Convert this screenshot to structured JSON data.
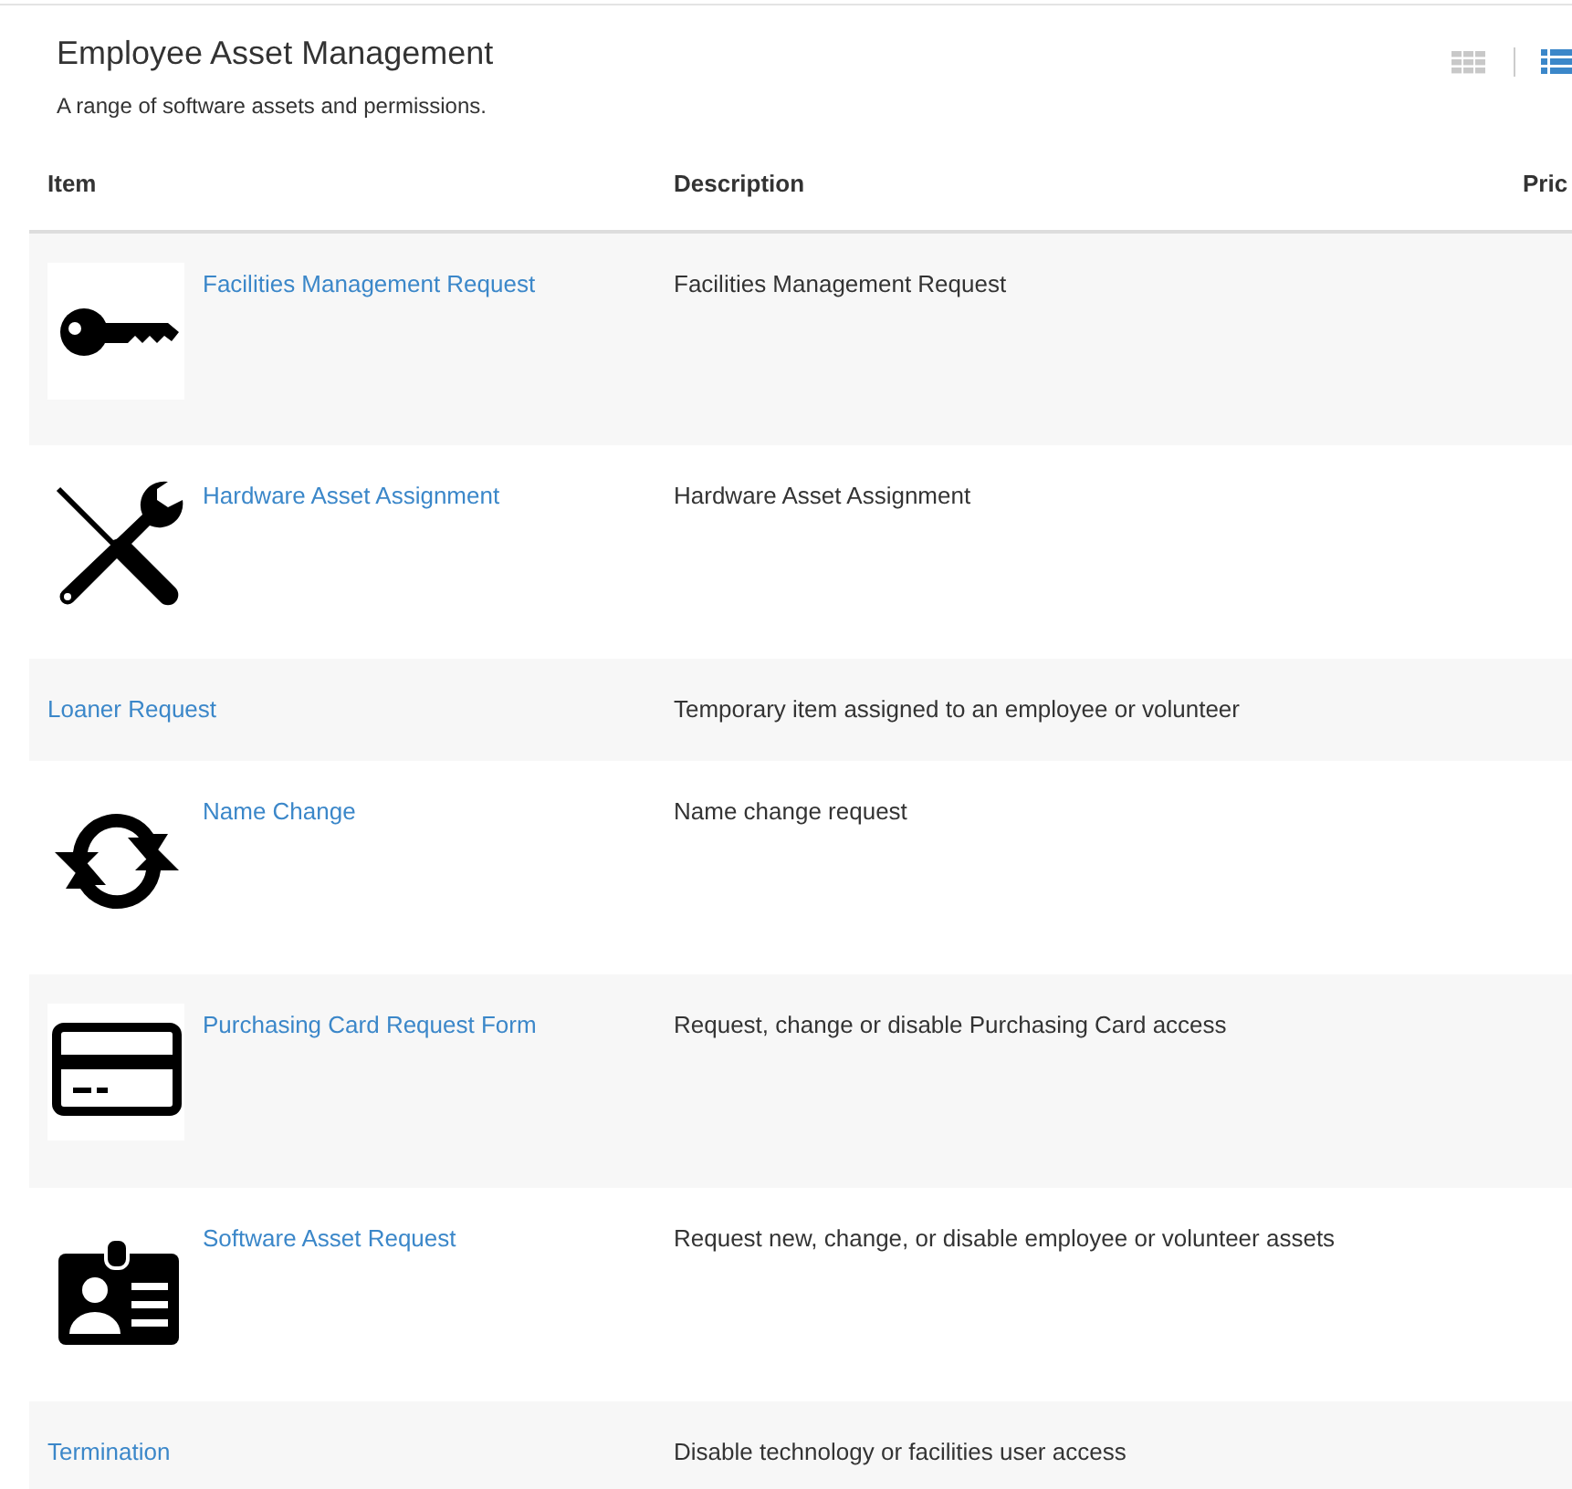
{
  "header": {
    "title": "Employee Asset Management",
    "subtitle": "A range of software assets and permissions."
  },
  "view_options": [
    {
      "kind": "grid",
      "selected": false
    },
    {
      "kind": "list",
      "selected": true
    }
  ],
  "table": {
    "columns": [
      "Item",
      "Description",
      "Pric"
    ],
    "rows": [
      {
        "kind": "key",
        "item": "Facilities Management Request",
        "description": "Facilities Management Request"
      },
      {
        "kind": "tools",
        "item": "Hardware Asset Assignment",
        "description": "Hardware Asset Assignment"
      },
      {
        "kind": "plain",
        "item": "Loaner Request",
        "description": "Temporary item assigned to an employee or volunteer"
      },
      {
        "kind": "sync",
        "item": "Name Change",
        "description": "Name change request"
      },
      {
        "kind": "card",
        "item": "Purchasing Card Request Form",
        "description": "Request, change or disable Purchasing Card access"
      },
      {
        "kind": "badge",
        "item": "Software Asset Request",
        "description": "Request new, change, or disable employee or volunteer assets"
      },
      {
        "kind": "plain",
        "item": "Termination",
        "description": "Disable technology or facilities user access"
      }
    ]
  }
}
